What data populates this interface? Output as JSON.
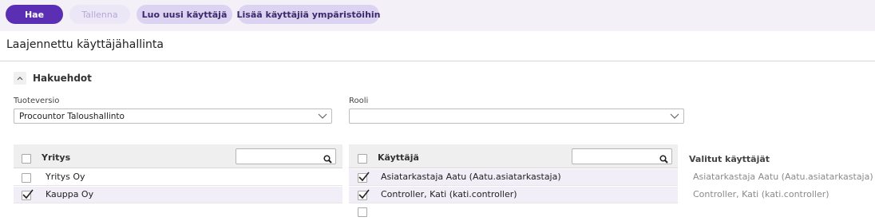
{
  "toolbar": {
    "search_label": "Hae",
    "save_label": "Tallenna",
    "new_user_label": "Luo uusi käyttäjä",
    "add_users_label": "Lisää käyttäjiä ympäristöihin"
  },
  "page": {
    "title": "Laajennettu käyttäjähallinta"
  },
  "criteria": {
    "section_title": "Hakuehdot",
    "product_version": {
      "label": "Tuoteversio",
      "value": "Procountor Taloushallinto"
    },
    "role": {
      "label": "Rooli",
      "value": ""
    }
  },
  "companies": {
    "header": "Yritys",
    "search_value": "",
    "rows": [
      {
        "name": "Yritys Oy",
        "checked": false
      },
      {
        "name": "Kauppa Oy",
        "checked": true
      }
    ]
  },
  "users": {
    "header": "Käyttäjä",
    "search_value": "",
    "rows": [
      {
        "name": "Asiatarkastaja Aatu (Aatu.asiatarkastaja)",
        "checked": true
      },
      {
        "name": "Controller, Kati (kati.controller)",
        "checked": true
      },
      {
        "name": "",
        "checked": false
      }
    ]
  },
  "selected_users": {
    "title": "Valitut käyttäjät",
    "items": [
      "Asiatarkastaja Aatu (Aatu.asiatarkastaja)",
      "Controller, Kati (kati.controller)"
    ]
  },
  "colors": {
    "primary": "#5b2fb3",
    "secondary": "#dcd2f1",
    "toolbar_bg": "#f3f1f7",
    "selected_row": "#f1eef8"
  },
  "icons": {
    "collapse": "chevron-up-icon",
    "dropdown": "chevron-down-icon",
    "search": "search-icon",
    "check": "checkmark-icon"
  }
}
